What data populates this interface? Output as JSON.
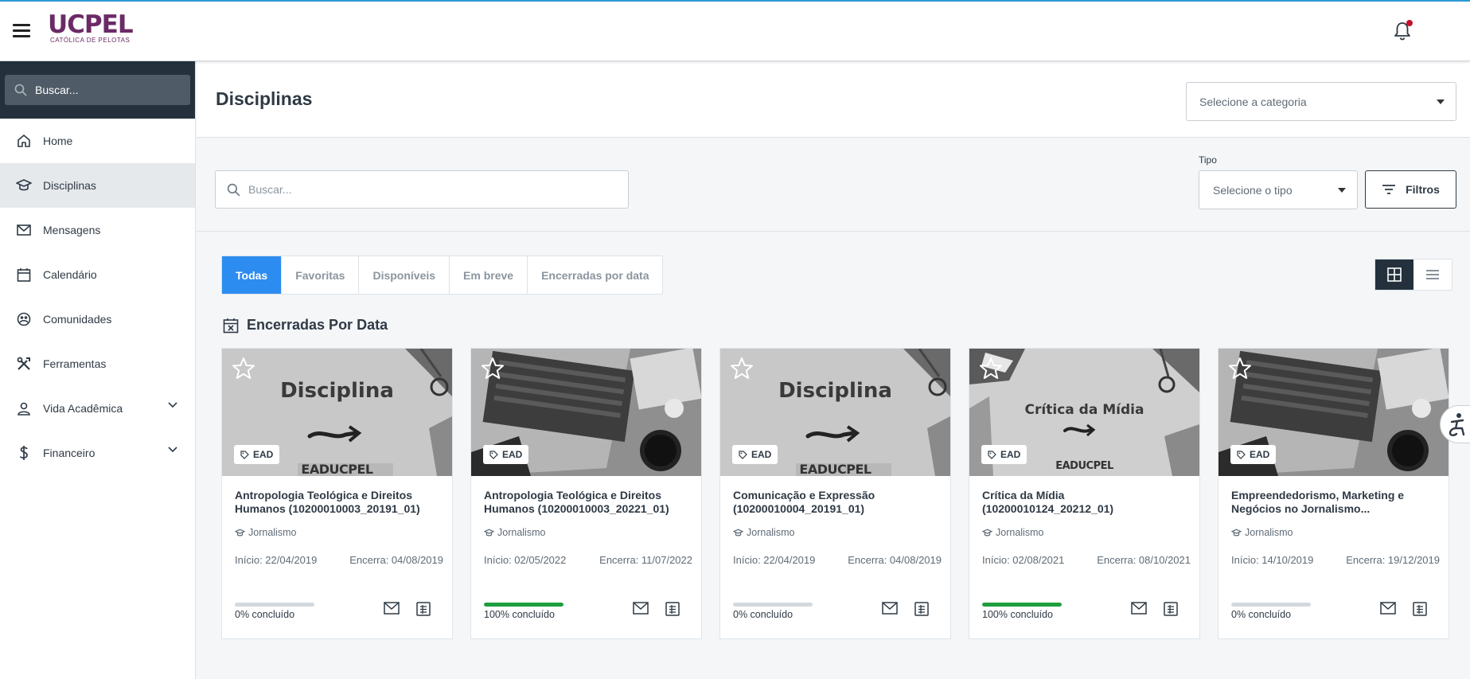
{
  "header": {
    "logo_text": "UCPEL",
    "logo_sub": "CATÓLICA DE PELOTAS"
  },
  "sidebar": {
    "search_placeholder": "Buscar...",
    "items": [
      {
        "label": "Home",
        "icon": "home-icon"
      },
      {
        "label": "Disciplinas",
        "icon": "graduation-cap-icon",
        "active": true
      },
      {
        "label": "Mensagens",
        "icon": "mail-icon"
      },
      {
        "label": "Calendário",
        "icon": "calendar-icon"
      },
      {
        "label": "Comunidades",
        "icon": "globe-icon"
      },
      {
        "label": "Ferramentas",
        "icon": "tools-icon"
      },
      {
        "label": "Vida Acadêmica",
        "icon": "user-badge-icon",
        "expandable": true
      },
      {
        "label": "Financeiro",
        "icon": "dollar-icon",
        "expandable": true
      }
    ]
  },
  "main": {
    "title": "Disciplinas",
    "category_placeholder": "Selecione a categoria",
    "search_placeholder": "Buscar...",
    "tipo_label": "Tipo",
    "tipo_placeholder": "Selecione o tipo",
    "filters_label": "Filtros",
    "tabs": [
      {
        "label": "Todas",
        "active": true
      },
      {
        "label": "Favoritas"
      },
      {
        "label": "Disponíveis"
      },
      {
        "label": "Em breve"
      },
      {
        "label": "Encerradas por data"
      }
    ],
    "section_title": "Encerradas Por Data"
  },
  "cards": [
    {
      "title": "Antropologia Teológica e Direitos Humanos (10200010003_20191_01)",
      "badge": "EAD",
      "course": "Jornalismo",
      "start": "Início: 22/04/2019",
      "end": "Encerra: 04/08/2019",
      "progress": 0,
      "progress_text": "0% concluído",
      "image_text": "Disciplina",
      "image_brand": "EADUCPEL",
      "image_kind": "disciplina"
    },
    {
      "title": "Antropologia Teológica e Direitos Humanos (10200010003_20221_01)",
      "badge": "EAD",
      "course": "Jornalismo",
      "start": "Início: 02/05/2022",
      "end": "Encerra: 11/07/2022",
      "progress": 100,
      "progress_text": "100% concluído",
      "image_kind": "laptop"
    },
    {
      "title": "Comunicação e Expressão (10200010004_20191_01)",
      "badge": "EAD",
      "course": "Jornalismo",
      "start": "Início: 22/04/2019",
      "end": "Encerra: 04/08/2019",
      "progress": 0,
      "progress_text": "0% concluído",
      "image_text": "Disciplina",
      "image_brand": "EADUCPEL",
      "image_kind": "disciplina"
    },
    {
      "title": "Crítica da Mídia (10200010124_20212_01)",
      "badge": "EAD",
      "course": "Jornalismo",
      "start": "Início: 02/08/2021",
      "end": "Encerra: 08/10/2021",
      "progress": 100,
      "progress_text": "100% concluído",
      "image_text": "Crítica da Mídia",
      "image_brand": "EADUCPEL",
      "image_kind": "disciplina-small"
    },
    {
      "title": "Empreendedorismo, Marketing e Negócios no Jornalismo...",
      "badge": "EAD",
      "course": "Jornalismo",
      "start": "Início: 14/10/2019",
      "end": "Encerra: 19/12/2019",
      "progress": 0,
      "progress_text": "0% concluído",
      "image_kind": "laptop"
    }
  ],
  "colors": {
    "accent": "#2d8cf0",
    "sidebar_dark": "#24313d",
    "brand": "#6b2a66",
    "progress_done": "#1e9e3e"
  }
}
